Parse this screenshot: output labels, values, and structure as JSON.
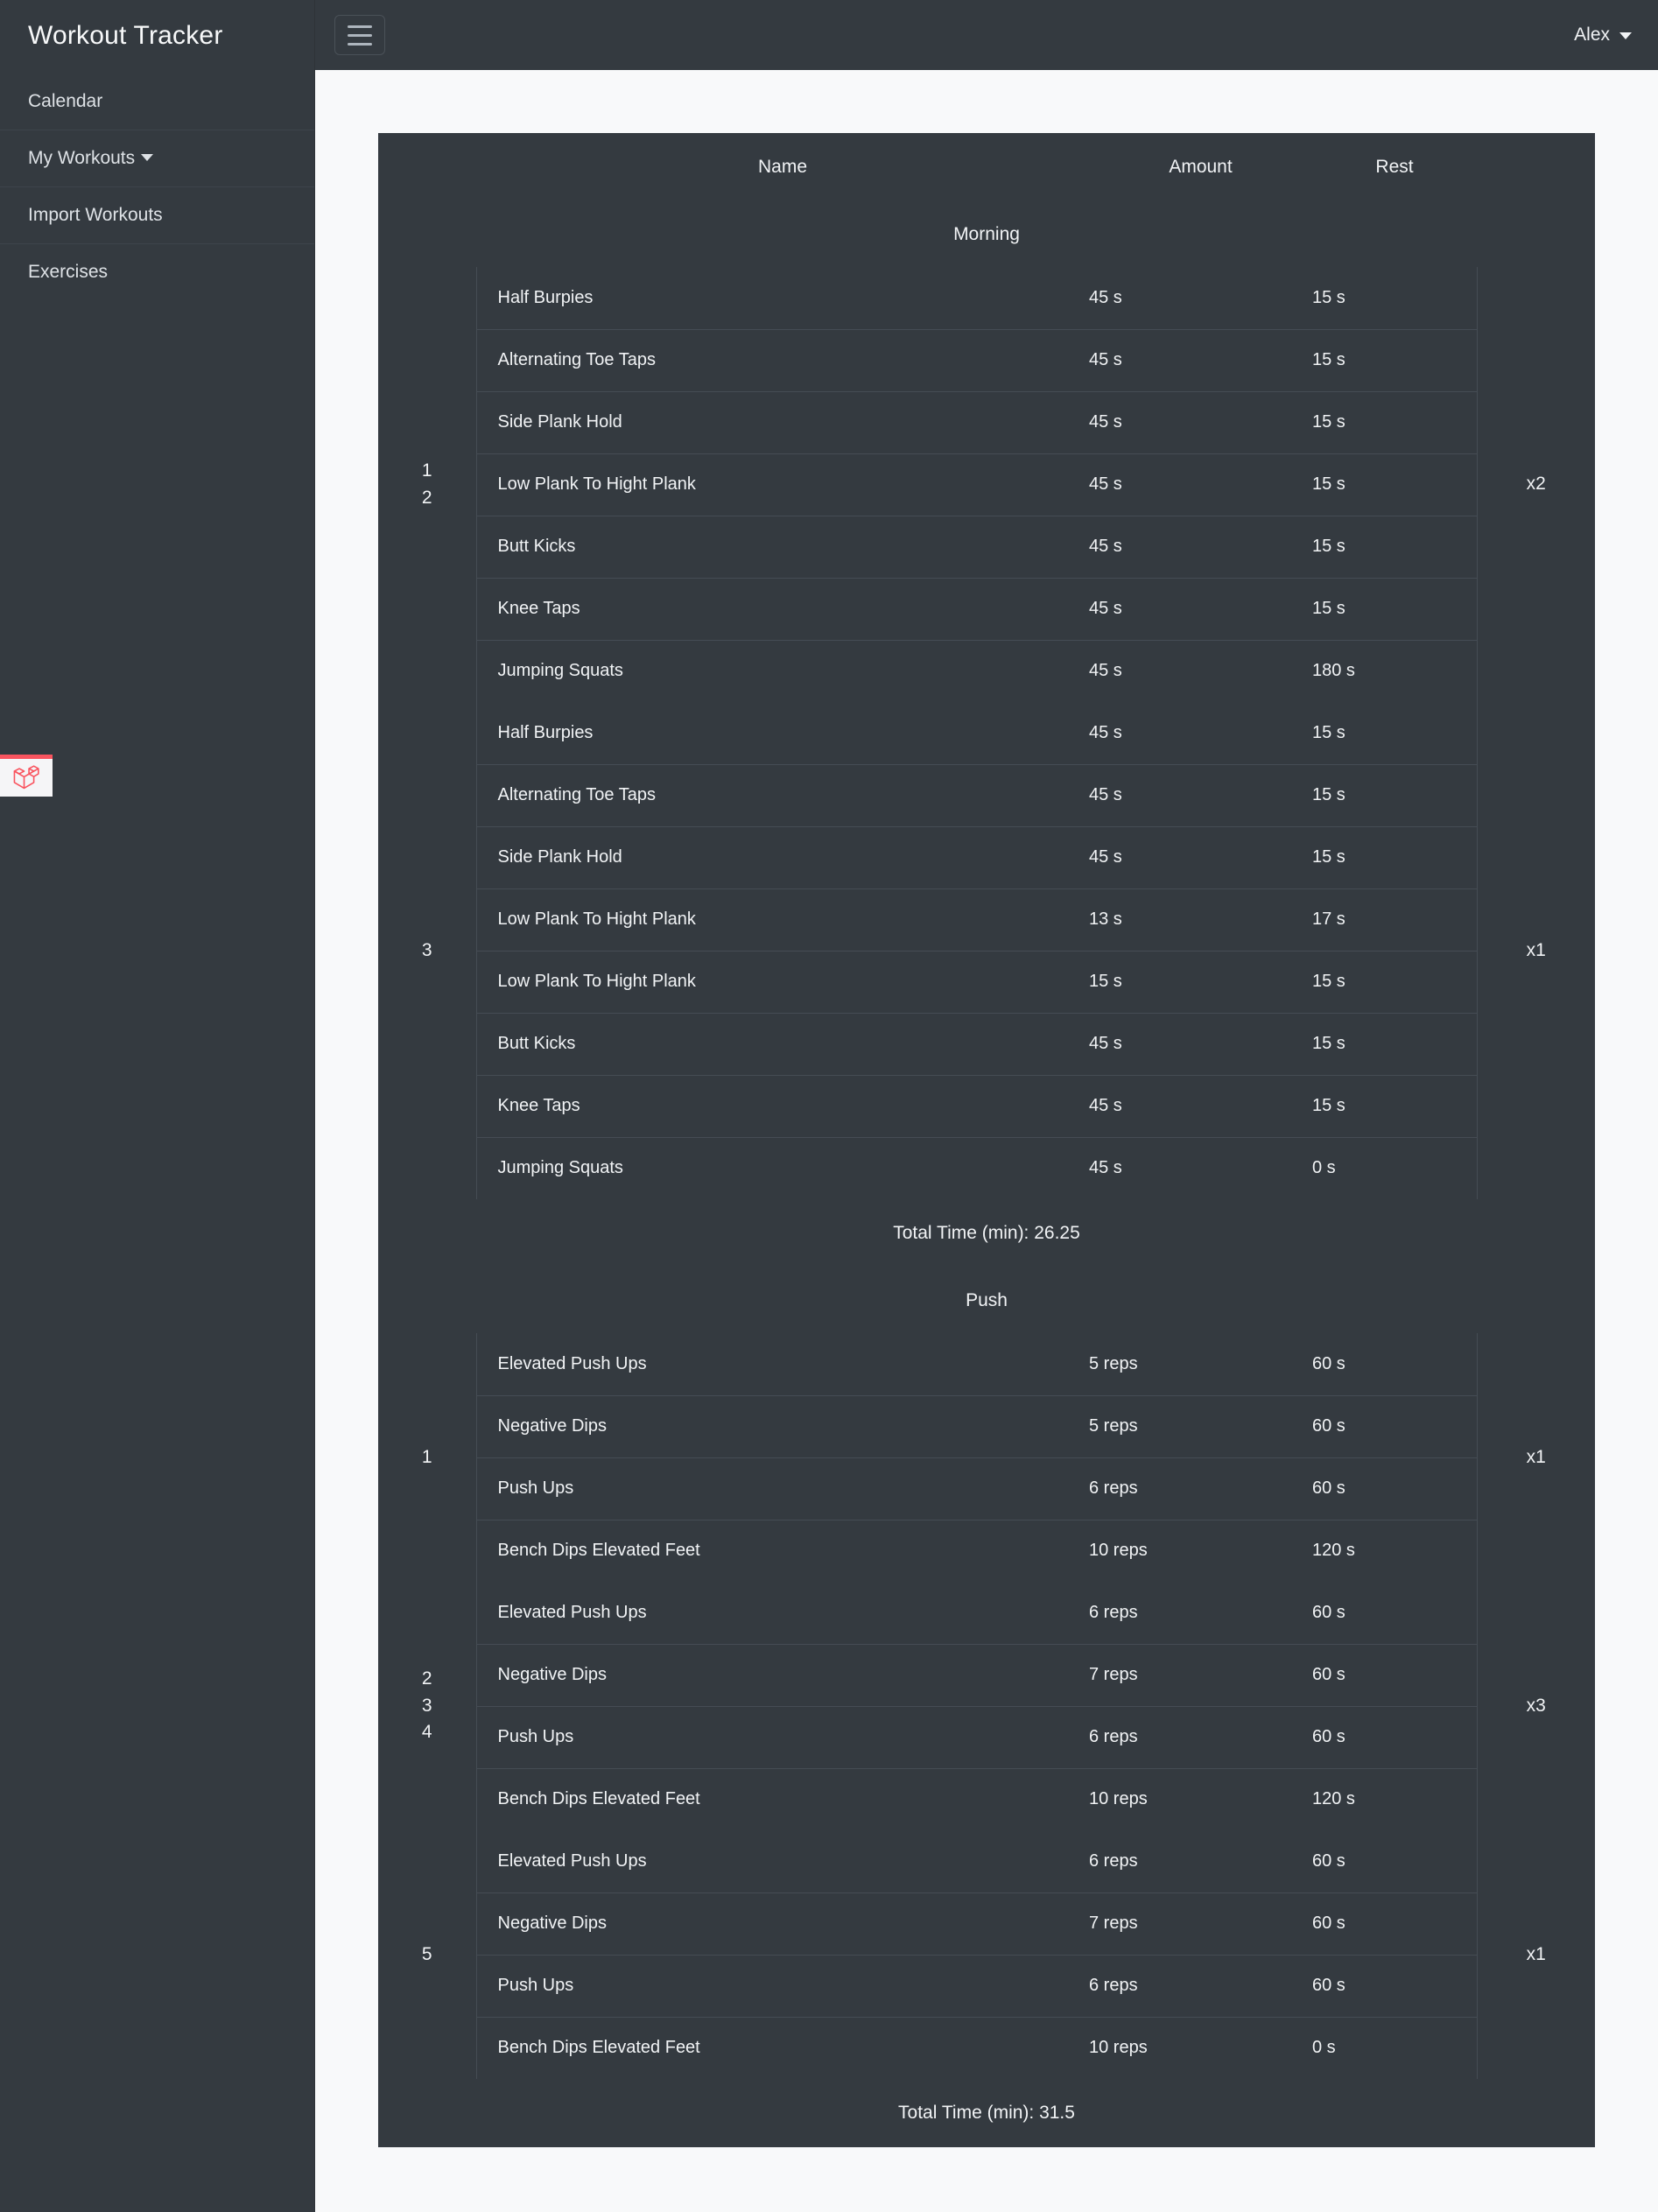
{
  "sidebar": {
    "brand": "Workout Tracker",
    "items": [
      {
        "label": "Calendar",
        "has_caret": false
      },
      {
        "label": "My Workouts",
        "has_caret": true
      },
      {
        "label": "Import Workouts",
        "has_caret": false
      },
      {
        "label": "Exercises",
        "has_caret": false
      }
    ],
    "badge_icon": "laravel-logo-icon",
    "badge_accent_color": "#f9545f"
  },
  "topbar": {
    "menu_toggle_icon": "hamburger-icon",
    "user_name": "Alex",
    "user_caret_icon": "chevron-down-icon"
  },
  "table": {
    "columns": [
      "",
      "Name",
      "Amount",
      "Rest",
      ""
    ],
    "sections": [
      {
        "title": "Morning",
        "total_label": "Total Time (min): 26.25",
        "groups": [
          {
            "set_numbers": [
              "1",
              "2"
            ],
            "repeat": "x2",
            "rows": [
              {
                "name": "Half Burpies",
                "amount": "45 s",
                "rest": "15 s"
              },
              {
                "name": "Alternating Toe Taps",
                "amount": "45 s",
                "rest": "15 s"
              },
              {
                "name": "Side Plank Hold",
                "amount": "45 s",
                "rest": "15 s"
              },
              {
                "name": "Low Plank To Hight Plank",
                "amount": "45 s",
                "rest": "15 s"
              },
              {
                "name": "Butt Kicks",
                "amount": "45 s",
                "rest": "15 s"
              },
              {
                "name": "Knee Taps",
                "amount": "45 s",
                "rest": "15 s"
              },
              {
                "name": "Jumping Squats",
                "amount": "45 s",
                "rest": "180 s"
              }
            ]
          },
          {
            "set_numbers": [
              "3"
            ],
            "repeat": "x1",
            "rows": [
              {
                "name": "Half Burpies",
                "amount": "45 s",
                "rest": "15 s"
              },
              {
                "name": "Alternating Toe Taps",
                "amount": "45 s",
                "rest": "15 s"
              },
              {
                "name": "Side Plank Hold",
                "amount": "45 s",
                "rest": "15 s"
              },
              {
                "name": "Low Plank To Hight Plank",
                "amount": "13 s",
                "rest": "17 s"
              },
              {
                "name": "Low Plank To Hight Plank",
                "amount": "15 s",
                "rest": "15 s"
              },
              {
                "name": "Butt Kicks",
                "amount": "45 s",
                "rest": "15 s"
              },
              {
                "name": "Knee Taps",
                "amount": "45 s",
                "rest": "15 s"
              },
              {
                "name": "Jumping Squats",
                "amount": "45 s",
                "rest": "0 s"
              }
            ]
          }
        ]
      },
      {
        "title": "Push",
        "total_label": "Total Time (min): 31.5",
        "groups": [
          {
            "set_numbers": [
              "1"
            ],
            "repeat": "x1",
            "rows": [
              {
                "name": "Elevated Push Ups",
                "amount": "5 reps",
                "rest": "60 s"
              },
              {
                "name": "Negative Dips",
                "amount": "5 reps",
                "rest": "60 s"
              },
              {
                "name": "Push Ups",
                "amount": "6 reps",
                "rest": "60 s"
              },
              {
                "name": "Bench Dips Elevated Feet",
                "amount": "10 reps",
                "rest": "120 s"
              }
            ]
          },
          {
            "set_numbers": [
              "2",
              "3",
              "4"
            ],
            "repeat": "x3",
            "rows": [
              {
                "name": "Elevated Push Ups",
                "amount": "6 reps",
                "rest": "60 s"
              },
              {
                "name": "Negative Dips",
                "amount": "7 reps",
                "rest": "60 s"
              },
              {
                "name": "Push Ups",
                "amount": "6 reps",
                "rest": "60 s"
              },
              {
                "name": "Bench Dips Elevated Feet",
                "amount": "10 reps",
                "rest": "120 s"
              }
            ]
          },
          {
            "set_numbers": [
              "5"
            ],
            "repeat": "x1",
            "rows": [
              {
                "name": "Elevated Push Ups",
                "amount": "6 reps",
                "rest": "60 s"
              },
              {
                "name": "Negative Dips",
                "amount": "7 reps",
                "rest": "60 s"
              },
              {
                "name": "Push Ups",
                "amount": "6 reps",
                "rest": "60 s"
              },
              {
                "name": "Bench Dips Elevated Feet",
                "amount": "10 reps",
                "rest": "0 s"
              }
            ]
          }
        ]
      }
    ]
  },
  "colors": {
    "sidebar_bg": "#343a40",
    "page_bg": "#f8f9fa",
    "table_bg": "#343a40",
    "text": "#f1f3f5",
    "divider": "#454c54",
    "section_divider": "#4b5560",
    "laravel_red": "#f9545f"
  }
}
